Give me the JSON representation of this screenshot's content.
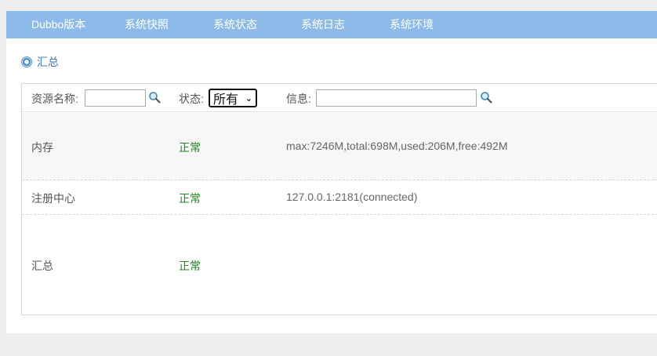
{
  "nav": {
    "items": [
      "Dubbo版本",
      "系统快照",
      "系统状态",
      "系统日志",
      "系统环境"
    ]
  },
  "summary": {
    "title": "汇总",
    "icon": "gear-icon"
  },
  "filters": {
    "resource_label": "资源名称:",
    "resource_value": "",
    "status_label": "状态:",
    "status_value": "所有",
    "info_label": "信息:",
    "info_value": "",
    "search_icon": "search-icon"
  },
  "rows": [
    {
      "name": "内存",
      "status": "正常",
      "info": "max:7246M,total:698M,used:206M,free:492M"
    },
    {
      "name": "注册中心",
      "status": "正常",
      "info": "127.0.0.1:2181(connected)"
    },
    {
      "name": "汇总",
      "status": "正常",
      "info": ""
    }
  ],
  "colors": {
    "nav_bg": "#8cbbe9",
    "status_ok": "#1e8a1e",
    "link": "#3d78b8"
  }
}
